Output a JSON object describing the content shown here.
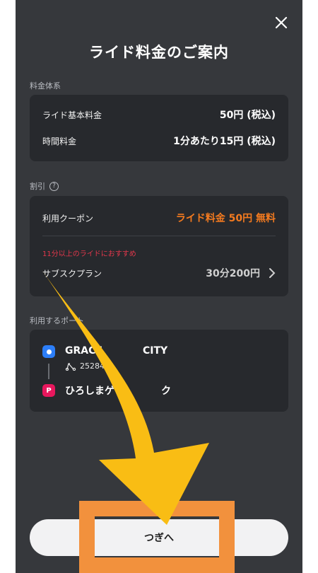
{
  "header": {
    "title": "ライド料金のご案内"
  },
  "fee_section": {
    "label": "料金体系",
    "rows": [
      {
        "label": "ライド基本料金",
        "value": "50円 (税込)"
      },
      {
        "label": "時間料金",
        "value": "1分あたり15円 (税込)"
      }
    ]
  },
  "discount_section": {
    "label": "割引",
    "help_icon": "?",
    "coupon": {
      "label": "利用クーポン",
      "value": "ライド料金 50円 無料"
    },
    "promo": "11分以上のライドにおすすめ",
    "subscription": {
      "label": "サブスクプラン",
      "value": "30分200円"
    }
  },
  "port_section": {
    "label": "利用するポート",
    "start": {
      "name": "GRACE",
      "name_right": "CITY",
      "vehicle_id": "25284"
    },
    "end": {
      "icon": "P",
      "name": "ひろしまゲー",
      "name_right": "ク"
    }
  },
  "footer": {
    "next_label": "つぎへ"
  },
  "colors": {
    "accent_orange": "#f37a1f",
    "promo_red": "#e2374b",
    "start_blue": "#2c7ef8",
    "end_pink": "#e8175d",
    "annotation_arrow": "#f9bd14",
    "annotation_box": "#f2913d"
  }
}
